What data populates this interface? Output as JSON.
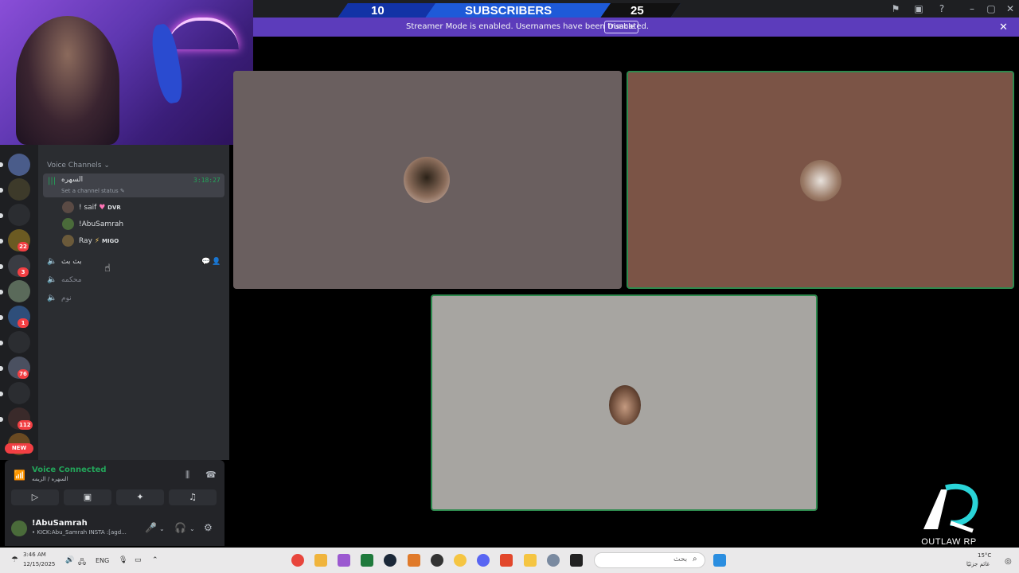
{
  "subscriber_bar": {
    "left_count": "10",
    "label": "SUBSCRIBERS",
    "right_count": "25"
  },
  "streamer_banner": {
    "text": "Streamer Mode is enabled. Usernames have been truncated.",
    "disable_label": "Disable"
  },
  "sidebar": {
    "section_header": "Voice Channels",
    "channels": [
      {
        "name": "السهره",
        "status": "Set a channel status",
        "timer": "3:18:27",
        "active": true
      },
      {
        "name": "بث بث",
        "active": false
      },
      {
        "name": "محكمه",
        "active": false
      },
      {
        "name": "نوم",
        "active": false
      }
    ],
    "members": [
      {
        "name": "! saif",
        "tag": "DVR",
        "tag_icon": "heart-icon"
      },
      {
        "name": "!AbuSamrah",
        "tag": ""
      },
      {
        "name": "Ray",
        "tag": "MIGO",
        "tag_icon": "bolt-icon"
      }
    ]
  },
  "server_badges": [
    "22",
    "3",
    "1",
    "76",
    "112"
  ],
  "new_badge": "NEW",
  "voice_panel": {
    "status": "Voice Connected",
    "location": "السهره / الزيمه"
  },
  "user_panel": {
    "name": "!AbuSamrah",
    "status": "• KICK:Abu_Samrah INSTA :[agd..."
  },
  "overlay_logo": {
    "text": "OUTLAW RP"
  },
  "taskbar": {
    "time": "3:46 AM",
    "date": "12/15/2025",
    "lang": "ENG",
    "search_placeholder": "بحث",
    "weather_temp": "15°C",
    "weather_desc": "غائم جزئيًا"
  },
  "colors": {
    "blurple_banner": "#5c3cbb",
    "voice_green": "#23a55a",
    "badge_red": "#f23f43",
    "sub_bar_blue": "#1e5ad8"
  }
}
